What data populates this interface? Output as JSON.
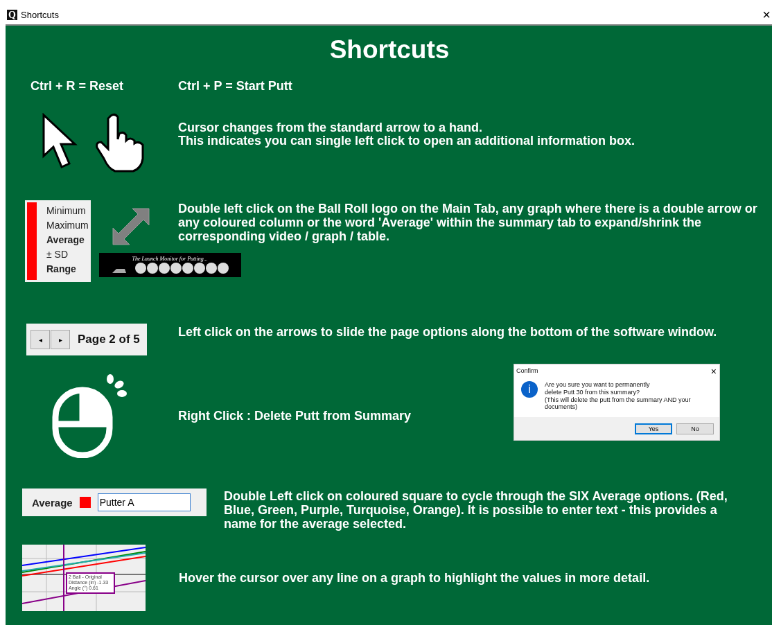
{
  "window": {
    "title": "Shortcuts",
    "app_icon": "Q",
    "close": "×"
  },
  "heading": "Shortcuts",
  "shortcuts": [
    "Ctrl + R = Reset",
    "Ctrl + P = Start Putt"
  ],
  "cursor_row": {
    "lines": [
      "Cursor changes from the standard arrow to a hand.",
      "This indicates you can single left click to open an additional information box."
    ]
  },
  "expand_row": {
    "stats": [
      {
        "label": "Minimum",
        "bold": false
      },
      {
        "label": "Maximum",
        "bold": false
      },
      {
        "label": "Average",
        "bold": true
      },
      {
        "label": "± SD",
        "bold": false
      },
      {
        "label": "Range",
        "bold": true
      }
    ],
    "logo_tagline": "The Launch Monitor for Putting...",
    "text": "Double left click on the Ball Roll logo on the Main Tab, any graph where there is a double arrow or any coloured column or the word 'Average' within the summary tab to expand/shrink the corresponding video / graph / table."
  },
  "page_row": {
    "prev": "◂",
    "next": "▸",
    "page": "Page 2 of 5",
    "text": "Left click on the arrows to slide the page options along the bottom of the software window."
  },
  "right_click_row": {
    "text": "Right Click : Delete Putt from Summary",
    "dialog": {
      "title": "Confirm",
      "close": "×",
      "icon": "i",
      "message": [
        "Are you sure you want to permanently",
        "delete Putt 30 from this summary?",
        "(This will delete the putt from the summary AND your documents)"
      ],
      "buttons": [
        {
          "label": "Yes",
          "selected": true
        },
        {
          "label": "No",
          "selected": false
        }
      ]
    }
  },
  "average_row": {
    "label": "Average",
    "color": "#ff0000",
    "value": "Putter A",
    "text": "Double Left click on coloured square to cycle through the SIX Average options. (Red, Blue, Green, Purple, Turquoise, Orange). It is possible to enter text - this provides a name for the average selected."
  },
  "hover_row": {
    "tooltip": [
      "2 Ball - Original",
      "Distance (in) -1.33",
      "Angle (°) 0.61"
    ],
    "text": "Hover the cursor over any line on a graph to highlight the values in more detail."
  }
}
